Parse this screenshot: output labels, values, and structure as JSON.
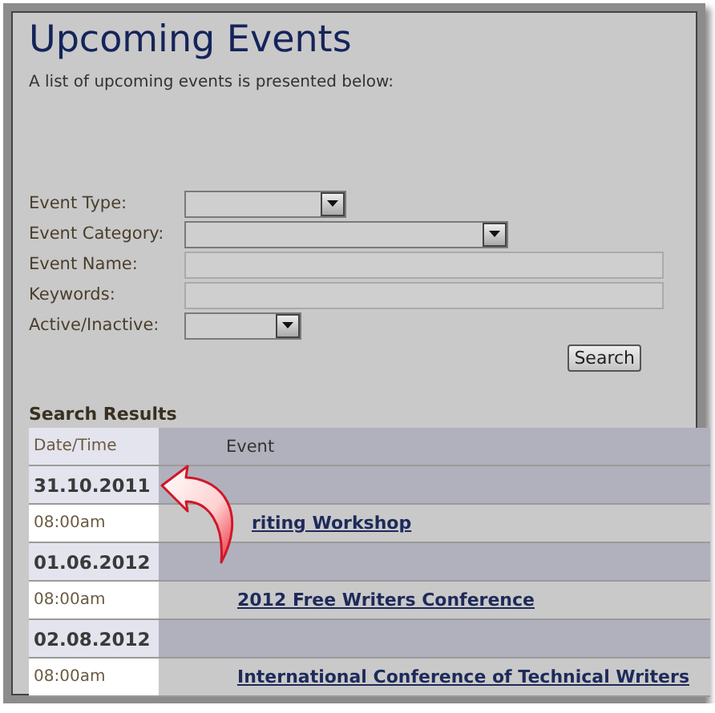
{
  "title": "Upcoming Events",
  "subtitle": "A list of upcoming events is presented below:",
  "filters": [
    {
      "label": "Event Type:",
      "kind": "select"
    },
    {
      "label": "Event Category:",
      "kind": "select"
    },
    {
      "label": "Event Name:",
      "kind": "text"
    },
    {
      "label": "Keywords:",
      "kind": "text"
    },
    {
      "label": "Active/Inactive:",
      "kind": "select"
    }
  ],
  "search_button": "Search",
  "results": {
    "heading": "Search Results",
    "columns": [
      "Date/Time",
      "Event"
    ],
    "groups": [
      {
        "date": "31.10.2011",
        "time": "08:00am",
        "event": "riting Workshop"
      },
      {
        "date": "01.06.2012",
        "time": "08:00am",
        "event": "2012 Free Writers Conference"
      },
      {
        "date": "02.08.2012",
        "time": "08:00am",
        "event": "International Conference of Technical Writers"
      }
    ]
  }
}
